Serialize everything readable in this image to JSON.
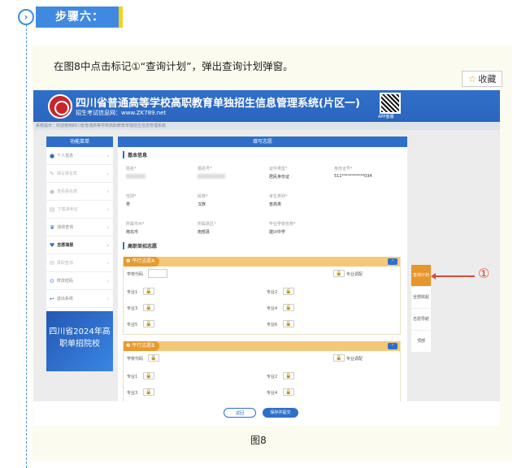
{
  "step": {
    "icon": "chevron-right-icon",
    "label": "步骤六："
  },
  "instruction": "在图8中点击标记①“查询计划”，弹出查询计划弹窗。",
  "favorite": {
    "icon": "star-icon",
    "label": "收藏"
  },
  "system": {
    "title": "四川省普通高等学校高职教育单独招生信息管理系统(片区一)",
    "url": "招生考试信息网：www.ZK789.net",
    "qr_label": "APP客服",
    "breadcrumb": "系统提示：欢迎使用四川省普通高等学校高职教育单独招生信息管理系统"
  },
  "menu": {
    "title": "功能菜单",
    "items": [
      {
        "icon": "user-icon",
        "label": "个人信息"
      },
      {
        "icon": "edit-icon",
        "label": "填写报名表"
      },
      {
        "icon": "search-icon",
        "label": "查看报名表"
      },
      {
        "icon": "print-icon",
        "label": "下载准考证"
      },
      {
        "icon": "trophy-icon",
        "label": "成绩查询"
      },
      {
        "icon": "heart-icon",
        "label": "志愿填报"
      },
      {
        "icon": "mail-icon",
        "label": "录取查询"
      },
      {
        "icon": "lock-icon",
        "label": "修改密码"
      },
      {
        "icon": "logout-icon",
        "label": "退出系统"
      }
    ],
    "banner": "四川省2024年高职单招院校"
  },
  "form": {
    "title": "填写志愿",
    "basic_section": "基本信息",
    "fields": [
      {
        "label": "姓名*",
        "value": ""
      },
      {
        "label": "报名号*",
        "value": ""
      },
      {
        "label": "证件类型*",
        "value": "居民身份证"
      },
      {
        "label": "身份证号*",
        "value": "511***********034"
      },
      {
        "label": "性别*",
        "value": "男"
      },
      {
        "label": "民族*",
        "value": "汉族"
      },
      {
        "label": "考生类别*",
        "value": "普高类"
      },
      {
        "label": "所属市州*",
        "value": "南充市"
      },
      {
        "label": "所属县区*",
        "value": "南部县"
      },
      {
        "label": "毕业学校名称*",
        "value": "建兴中学"
      }
    ],
    "wish_section": "高职单招志愿",
    "groups": [
      {
        "num": "1",
        "title": "平行志愿A",
        "school": "学校代码",
        "adjust": "专业调配",
        "majors": [
          "专业1",
          "专业2",
          "专业3",
          "专业4",
          "专业5",
          "专业6"
        ]
      },
      {
        "num": "2",
        "title": "平行志愿B",
        "school": "学校代码",
        "adjust": "专业调配",
        "majors": [
          "专业1",
          "专业2",
          "专业3",
          "专业4"
        ]
      }
    ],
    "lock_icon": "🔒"
  },
  "right_bar": [
    {
      "label": "查询计划",
      "active": true
    },
    {
      "label": "全部收起",
      "active": false
    },
    {
      "label": "志愿导航",
      "active": false
    },
    {
      "label": "顶部",
      "active": false
    }
  ],
  "buttons": {
    "back": "返回",
    "save": "保存并提交"
  },
  "annotation": "①",
  "caption": "图8"
}
